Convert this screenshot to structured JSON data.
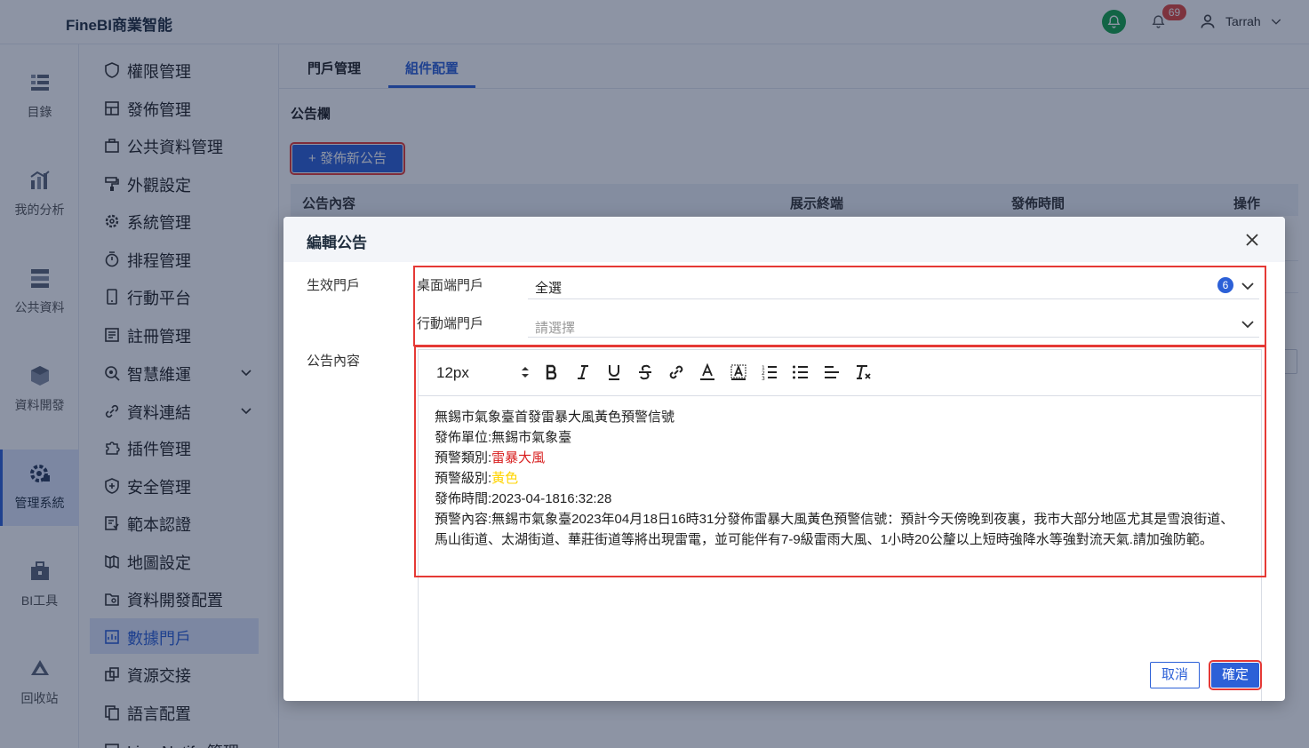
{
  "header": {
    "brand": "FineBI商業智能",
    "notification_count": "69",
    "user_name": "Tarrah"
  },
  "rail": {
    "items": [
      {
        "label": "目錄",
        "icon": "catalog-icon"
      },
      {
        "label": "我的分析",
        "icon": "analysis-icon"
      },
      {
        "label": "公共資料",
        "icon": "public-data-icon"
      },
      {
        "label": "資料開發",
        "icon": "data-dev-icon"
      },
      {
        "label": "管理系統",
        "icon": "gear-icon",
        "active": true
      },
      {
        "label": "BI工具",
        "icon": "toolbox-icon"
      },
      {
        "label": "回收站",
        "icon": "recycle-icon"
      }
    ]
  },
  "menu": {
    "items": [
      {
        "label": "權限管理"
      },
      {
        "label": "發佈管理"
      },
      {
        "label": "公共資料管理"
      },
      {
        "label": "外觀設定"
      },
      {
        "label": "系統管理"
      },
      {
        "label": "排程管理"
      },
      {
        "label": "行動平台"
      },
      {
        "label": "註冊管理"
      },
      {
        "label": "智慧維運"
      },
      {
        "label": "資料連結"
      },
      {
        "label": "插件管理"
      },
      {
        "label": "安全管理"
      },
      {
        "label": "範本認證"
      },
      {
        "label": "地圖設定"
      },
      {
        "label": "資料開發配置"
      },
      {
        "label": "數據門戶"
      },
      {
        "label": "資源交接"
      },
      {
        "label": "語言配置"
      },
      {
        "label": "Line Notify 管理"
      }
    ]
  },
  "tabs": {
    "portal_mgmt": "門戶管理",
    "component_config": "組件配置"
  },
  "bulletin": {
    "section_title": "公告欄",
    "publish_button": "+ 發佈新公告",
    "columns": {
      "content": "公告內容",
      "terminal": "展示終端",
      "time": "發佈時間",
      "action": "操作"
    }
  },
  "dialog": {
    "title": "編輯公告",
    "label_portal": "生效門戶",
    "label_content": "公告內容",
    "desktop_label": "桌面端門戶",
    "desktop_value": "全選",
    "desktop_count": "6",
    "mobile_label": "行動端門戶",
    "mobile_placeholder": "請選擇",
    "font_size": "12px",
    "text": {
      "line1": "無錫市氣象臺首發雷暴大風黃色預警信號",
      "unit_label": "發佈單位:",
      "unit_value": "無錫市氣象臺",
      "type_label": "預警類別:",
      "type_value": "雷暴大風",
      "level_label": "預警級別:",
      "level_value": "黃色",
      "time_label": "發佈時間:",
      "time_value": "2023-04-1816:32:28",
      "content_label": "預警內容:",
      "content_value": "無錫市氣象臺2023年04月18日16時31分發佈雷暴大風黃色預警信號：預計今天傍晚到夜裏，我市大部分地區尤其是雪浪街道、馬山街道、太湖街道、華莊街道等將出現雷電，並可能伴有7-9級雷雨大風、1小時20公釐以上短時強降水等強對流天氣.請加強防範。"
    },
    "cancel": "取消",
    "confirm": "確定"
  },
  "colors": {
    "primary": "#2c60d7",
    "highlight": "#e53935",
    "danger_text": "#d81f1f",
    "yellow_text": "#ffd400",
    "notify_green": "#15a34a"
  }
}
